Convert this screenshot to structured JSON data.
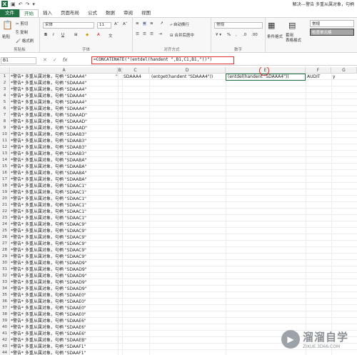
{
  "titlebar": {
    "title": "解决---警告 多重从属对象，句柄"
  },
  "tabs": [
    "文件",
    "开始",
    "插入",
    "页面布局",
    "公式",
    "数据",
    "审阅",
    "视图"
  ],
  "ribbon": {
    "clipboard": {
      "paste": "粘贴",
      "cut": "剪切",
      "copy": "复制",
      "painter": "格式刷",
      "label": "剪贴板"
    },
    "font": {
      "name": "宋体",
      "size": "11",
      "bold": "B",
      "italic": "I",
      "underline": "U",
      "label": "字体"
    },
    "align": {
      "wrap": "自动换行",
      "merge": "合并后居中",
      "label": "对齐方式"
    },
    "number": {
      "format": "常规",
      "label": "数字"
    },
    "styles": {
      "cond": "条件格式",
      "table": "套用\n表格格式",
      "normal": "常规",
      "check": "检查单元格"
    }
  },
  "formula_bar": {
    "namebox": "B1",
    "formula": "=CONCATENATE(\"(entdel(handent \",B1,C1,B1,\"))\")"
  },
  "columns": [
    "A",
    "B",
    "C",
    "D",
    "E",
    "F",
    "G"
  ],
  "row1": {
    "B": "\"",
    "C": "SDAAA4",
    "D": "(entget(handent \"SDAAA4\"))",
    "E": "(entdel(handent \"SDAAA4\"))",
    "F": "AUDIT",
    "G": "y"
  },
  "rows": [
    {
      "n": "1",
      "a": "*警告* 多重从属对象，句柄 \"SDAAA4\""
    },
    {
      "n": "2",
      "a": "*警告* 多重从属对象，句柄 \"SDAAA4\""
    },
    {
      "n": "3",
      "a": "*警告* 多重从属对象，句柄 \"SDAAA4\""
    },
    {
      "n": "4",
      "a": "*警告* 多重从属对象，句柄 \"SDAAA4\""
    },
    {
      "n": "5",
      "a": "*警告* 多重从属对象，句柄 \"SDAAA4\""
    },
    {
      "n": "6",
      "a": "*警告* 多重从属对象，句柄 \"SDAAA4\""
    },
    {
      "n": "7",
      "a": "*警告* 多重从属对象，句柄 \"SDAAAD\""
    },
    {
      "n": "8",
      "a": "*警告* 多重从属对象，句柄 \"SDAAAD\""
    },
    {
      "n": "9",
      "a": "*警告* 多重从属对象，句柄 \"SDAAAD\""
    },
    {
      "n": "10",
      "a": "*警告* 多重从属对象，句柄 \"SDAAB3\""
    },
    {
      "n": "11",
      "a": "*警告* 多重从属对象，句柄 \"SDAAB3\""
    },
    {
      "n": "12",
      "a": "*警告* 多重从属对象，句柄 \"SDAAB3\""
    },
    {
      "n": "13",
      "a": "*警告* 多重从属对象，句柄 \"SDAAB3\""
    },
    {
      "n": "14",
      "a": "*警告* 多重从属对象，句柄 \"SDAABA\""
    },
    {
      "n": "15",
      "a": "*警告* 多重从属对象，句柄 \"SDAABA\""
    },
    {
      "n": "16",
      "a": "*警告* 多重从属对象，句柄 \"SDAABA\""
    },
    {
      "n": "17",
      "a": "*警告* 多重从属对象，句柄 \"SDAABA\""
    },
    {
      "n": "18",
      "a": "*警告* 多重从属对象，句柄 \"SDAAC1\""
    },
    {
      "n": "19",
      "a": "*警告* 多重从属对象，句柄 \"SDAAC1\""
    },
    {
      "n": "20",
      "a": "*警告* 多重从属对象，句柄 \"SDAAC1\""
    },
    {
      "n": "21",
      "a": "*警告* 多重从属对象，句柄 \"SDAAC1\""
    },
    {
      "n": "22",
      "a": "*警告* 多重从属对象，句柄 \"SDAAC1\""
    },
    {
      "n": "23",
      "a": "*警告* 多重从属对象，句柄 \"SDAAC1\""
    },
    {
      "n": "24",
      "a": "*警告* 多重从属对象，句柄 \"SDAAC9\""
    },
    {
      "n": "25",
      "a": "*警告* 多重从属对象，句柄 \"SDAAC9\""
    },
    {
      "n": "26",
      "a": "*警告* 多重从属对象，句柄 \"SDAAC9\""
    },
    {
      "n": "27",
      "a": "*警告* 多重从属对象，句柄 \"SDAAC9\""
    },
    {
      "n": "28",
      "a": "*警告* 多重从属对象，句柄 \"SDAAC9\""
    },
    {
      "n": "29",
      "a": "*警告* 多重从属对象，句柄 \"SDAAC9\""
    },
    {
      "n": "30",
      "a": "*警告* 多重从属对象，句柄 \"SDAAD9\""
    },
    {
      "n": "31",
      "a": "*警告* 多重从属对象，句柄 \"SDAAD9\""
    },
    {
      "n": "32",
      "a": "*警告* 多重从属对象，句柄 \"SDAAD9\""
    },
    {
      "n": "33",
      "a": "*警告* 多重从属对象，句柄 \"SDAAD9\""
    },
    {
      "n": "34",
      "a": "*警告* 多重从属对象，句柄 \"SDAAD9\""
    },
    {
      "n": "35",
      "a": "*警告* 多重从属对象，句柄 \"SDAAE0\""
    },
    {
      "n": "36",
      "a": "*警告* 多重从属对象，句柄 \"SDAAE0\""
    },
    {
      "n": "37",
      "a": "*警告* 多重从属对象，句柄 \"SDAAE0\""
    },
    {
      "n": "38",
      "a": "*警告* 多重从属对象，句柄 \"SDAAE0\""
    },
    {
      "n": "39",
      "a": "*警告* 多重从属对象，句柄 \"SDAAE6\""
    },
    {
      "n": "40",
      "a": "*警告* 多重从属对象，句柄 \"SDAAE6\""
    },
    {
      "n": "41",
      "a": "*警告* 多重从属对象，句柄 \"SDAAE6\""
    },
    {
      "n": "42",
      "a": "*警告* 多重从属对象，句柄 \"SDAAEB\""
    },
    {
      "n": "43",
      "a": "*警告* 多重从属对象，句柄 \"SDAAF1\""
    },
    {
      "n": "44",
      "a": "*警告* 多重从属对象，句柄 \"SDAAF1\""
    }
  ],
  "watermark": {
    "text": "溜溜自学",
    "url": "ZIXUE.3D66.COM"
  }
}
